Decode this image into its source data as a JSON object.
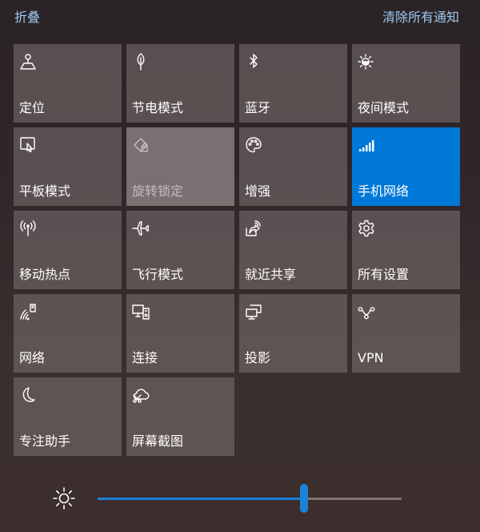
{
  "header": {
    "collapse_label": "折叠",
    "clear_label": "清除所有通知"
  },
  "colors": {
    "accent": "#0078d7",
    "link": "#9ec8ef",
    "tile": "#6f6262"
  },
  "tiles": [
    {
      "label": "定位",
      "icon": "location-icon",
      "state": "normal"
    },
    {
      "label": "节电模式",
      "icon": "battery-saver-leaf-icon",
      "state": "normal"
    },
    {
      "label": "蓝牙",
      "icon": "bluetooth-icon",
      "state": "normal"
    },
    {
      "label": "夜间模式",
      "icon": "night-light-icon",
      "state": "normal"
    },
    {
      "label": "平板模式",
      "icon": "tablet-mode-icon",
      "state": "normal"
    },
    {
      "label": "旋转锁定",
      "icon": "rotation-lock-icon",
      "state": "disabled"
    },
    {
      "label": "增强",
      "icon": "palette-icon",
      "state": "normal"
    },
    {
      "label": "手机网络",
      "icon": "cellular-signal-icon",
      "state": "active"
    },
    {
      "label": "移动热点",
      "icon": "mobile-hotspot-icon",
      "state": "normal"
    },
    {
      "label": "飞行模式",
      "icon": "airplane-icon",
      "state": "normal"
    },
    {
      "label": "就近共享",
      "icon": "nearby-share-icon",
      "state": "normal"
    },
    {
      "label": "所有设置",
      "icon": "gear-icon",
      "state": "normal"
    },
    {
      "label": "网络",
      "icon": "network-icon",
      "state": "normal"
    },
    {
      "label": "连接",
      "icon": "connect-icon",
      "state": "normal"
    },
    {
      "label": "投影",
      "icon": "project-icon",
      "state": "normal"
    },
    {
      "label": "VPN",
      "icon": "vpn-icon",
      "state": "normal"
    },
    {
      "label": "专注助手",
      "icon": "moon-icon",
      "state": "normal"
    },
    {
      "label": "屏幕截图",
      "icon": "screen-snip-icon",
      "state": "normal"
    }
  ],
  "brightness": {
    "icon": "brightness-sun-icon",
    "value_fraction": 0.68
  }
}
